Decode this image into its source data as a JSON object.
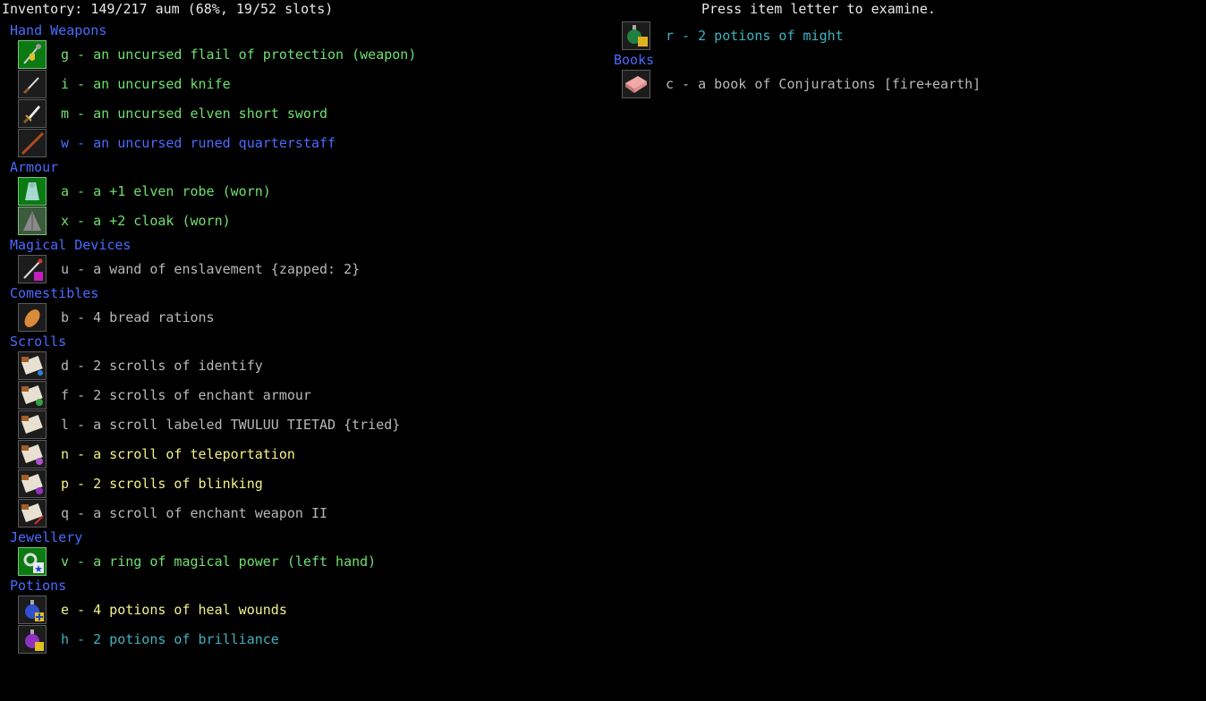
{
  "header": {
    "inventory": "Inventory: 149/217 aum (68%, 19/52 slots)",
    "prompt": "Press item letter to examine."
  },
  "categories": {
    "hand_weapons": "Hand Weapons",
    "armour": "Armour",
    "magical_devices": "Magical Devices",
    "comestibles": "Comestibles",
    "scrolls": "Scrolls",
    "jewellery": "Jewellery",
    "potions": "Potions",
    "books": "Books"
  },
  "items": {
    "g": "g - an uncursed flail of protection (weapon)",
    "i": "i - an uncursed knife",
    "m": "m - an uncursed elven short sword",
    "w": "w - an uncursed runed quarterstaff",
    "a": "a - a +1 elven robe (worn)",
    "x": "x - a +2 cloak (worn)",
    "u": "u - a wand of enslavement {zapped: 2}",
    "b": "b - 4 bread rations",
    "d": "d - 2 scrolls of identify",
    "f": "f - 2 scrolls of enchant armour",
    "l": "l - a scroll labeled TWULUU TIETAD {tried}",
    "n": "n - a scroll of teleportation",
    "p": "p - 2 scrolls of blinking",
    "q": "q - a scroll of enchant weapon II",
    "v": "v - a ring of magical power (left hand)",
    "e": "e - 4 potions of heal wounds",
    "h": "h - 2 potions of brilliance",
    "r": "r - 2 potions of might",
    "c": "c - a book of Conjurations [fire+earth]"
  },
  "colors": {
    "equipped": "#6fe06f",
    "category": "#4a6bff",
    "plain": "#b8b8b8",
    "unidentified_useful": "#f2f28a",
    "potion": "#3fb2c0"
  }
}
